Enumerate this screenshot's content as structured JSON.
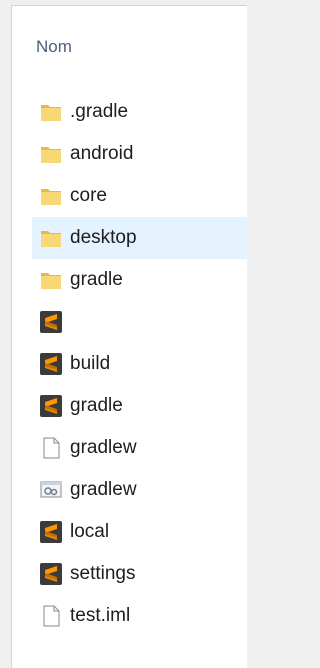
{
  "column_header": "Nom",
  "files": [
    {
      "name": ".gradle",
      "icon": "folder-icon",
      "selected": false
    },
    {
      "name": "android",
      "icon": "folder-icon",
      "selected": false
    },
    {
      "name": "core",
      "icon": "folder-icon",
      "selected": false
    },
    {
      "name": "desktop",
      "icon": "folder-icon",
      "selected": true
    },
    {
      "name": "gradle",
      "icon": "folder-icon",
      "selected": false
    },
    {
      "name": "",
      "icon": "sublime-file-icon",
      "selected": false
    },
    {
      "name": "build",
      "icon": "sublime-file-icon",
      "selected": false
    },
    {
      "name": "gradle",
      "icon": "sublime-file-icon",
      "selected": false
    },
    {
      "name": "gradlew",
      "icon": "blank-file-icon",
      "selected": false
    },
    {
      "name": "gradlew",
      "icon": "batch-file-icon",
      "selected": false
    },
    {
      "name": "local",
      "icon": "sublime-file-icon",
      "selected": false
    },
    {
      "name": "settings",
      "icon": "sublime-file-icon",
      "selected": false
    },
    {
      "name": "test.iml",
      "icon": "blank-file-icon",
      "selected": false
    }
  ],
  "colors": {
    "folder": "#f8d775",
    "folder_dark": "#e8b94a",
    "sublime_bg": "#3b3b3b",
    "sublime_accent": "#ff9800",
    "selection": "#e5f3ff",
    "header_text": "#4c607a"
  }
}
